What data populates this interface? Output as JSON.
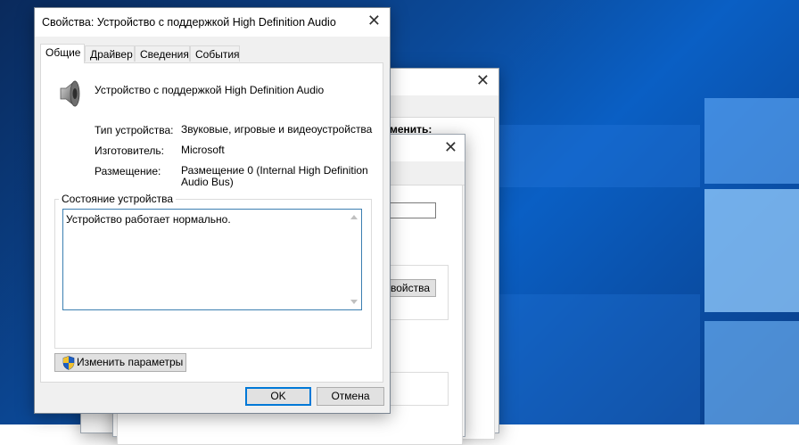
{
  "background_window_1": {
    "label_fragment": "менить:"
  },
  "background_window_2": {
    "button_fragment": "войства"
  },
  "dialog": {
    "title": "Свойства: Устройство с поддержкой High Definition Audio",
    "close_glyph": "✕",
    "tabs": [
      {
        "label": "Общие",
        "active": true
      },
      {
        "label": "Драйвер",
        "active": false
      },
      {
        "label": "Сведения",
        "active": false
      },
      {
        "label": "События",
        "active": false
      }
    ],
    "device_name": "Устройство с поддержкой High Definition Audio",
    "device_icon": "speaker-icon",
    "properties": [
      {
        "label": "Тип устройства:",
        "value": "Звуковые, игровые и видеоустройства"
      },
      {
        "label": "Изготовитель:",
        "value": "Microsoft"
      },
      {
        "label": "Размещение:",
        "value": "Размещение 0 (Internal High Definition Audio Bus)"
      }
    ],
    "status_group_title": "Состояние устройства",
    "status_text": "Устройство работает нормально.",
    "change_settings_button": "Изменить параметры",
    "change_settings_icon": "uac-shield-icon",
    "ok_button": "OK",
    "cancel_button": "Отмена"
  },
  "colors": {
    "accent": "#0078d7",
    "dialog_bg": "#f0f0f0",
    "desktop_blue": "#0b4a9a"
  }
}
